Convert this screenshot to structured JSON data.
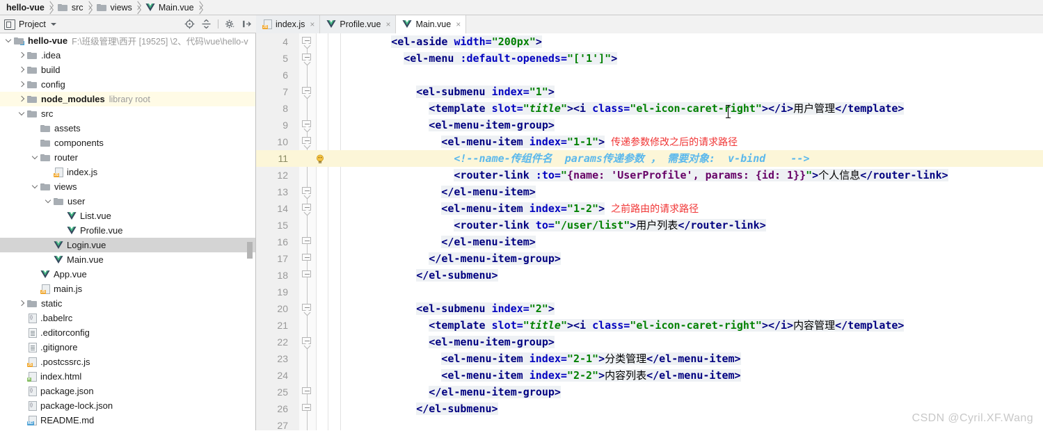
{
  "breadcrumb": {
    "items": [
      {
        "label": "hello-vue",
        "icon": "none",
        "bold": true
      },
      {
        "label": "src",
        "icon": "folder-icon",
        "bold": false
      },
      {
        "label": "views",
        "icon": "folder-icon",
        "bold": false
      },
      {
        "label": "Main.vue",
        "icon": "vue-icon",
        "bold": false
      }
    ]
  },
  "toolbar": {
    "project_label": "Project",
    "icons": [
      {
        "name": "locate-target-icon",
        "title": "Select Opened File"
      },
      {
        "name": "collapse-all-icon",
        "title": "Collapse All"
      },
      {
        "name": "settings-gear-icon",
        "title": "Show Options Menu"
      },
      {
        "name": "hide-panel-icon",
        "title": "Hide"
      }
    ]
  },
  "tabs": [
    {
      "label": "index.js",
      "icon": "js-file-icon",
      "active": false,
      "close": "×"
    },
    {
      "label": "Profile.vue",
      "icon": "vue-file-icon",
      "active": false,
      "close": "×"
    },
    {
      "label": "Main.vue",
      "icon": "vue-file-icon",
      "active": true,
      "close": "×"
    }
  ],
  "project_tree": [
    {
      "depth": 0,
      "arrow": "down",
      "icon": "project-folder-icon",
      "label": "hello-vue",
      "bold": true,
      "sub": "F:\\班级管理\\西开 [19525] \\2、代码\\vue\\hello-v",
      "state": "normal"
    },
    {
      "depth": 1,
      "arrow": "right",
      "icon": "folder-icon",
      "label": ".idea",
      "bold": false,
      "sub": "",
      "state": "normal"
    },
    {
      "depth": 1,
      "arrow": "right",
      "icon": "folder-icon",
      "label": "build",
      "bold": false,
      "sub": "",
      "state": "normal"
    },
    {
      "depth": 1,
      "arrow": "right",
      "icon": "folder-icon",
      "label": "config",
      "bold": false,
      "sub": "",
      "state": "normal"
    },
    {
      "depth": 1,
      "arrow": "right",
      "icon": "folder-icon",
      "label": "node_modules",
      "bold": true,
      "sub": "library root",
      "state": "library"
    },
    {
      "depth": 1,
      "arrow": "down",
      "icon": "folder-icon",
      "label": "src",
      "bold": false,
      "sub": "",
      "state": "normal"
    },
    {
      "depth": 2,
      "arrow": "none",
      "icon": "folder-icon",
      "label": "assets",
      "bold": false,
      "sub": "",
      "state": "normal"
    },
    {
      "depth": 2,
      "arrow": "none",
      "icon": "folder-icon",
      "label": "components",
      "bold": false,
      "sub": "",
      "state": "normal"
    },
    {
      "depth": 2,
      "arrow": "down",
      "icon": "folder-icon",
      "label": "router",
      "bold": false,
      "sub": "",
      "state": "normal"
    },
    {
      "depth": 3,
      "arrow": "none",
      "icon": "js-file-icon",
      "label": "index.js",
      "bold": false,
      "sub": "",
      "state": "normal"
    },
    {
      "depth": 2,
      "arrow": "down",
      "icon": "folder-icon",
      "label": "views",
      "bold": false,
      "sub": "",
      "state": "normal"
    },
    {
      "depth": 3,
      "arrow": "down",
      "icon": "folder-icon",
      "label": "user",
      "bold": false,
      "sub": "",
      "state": "normal"
    },
    {
      "depth": 4,
      "arrow": "none",
      "icon": "vue-file-icon",
      "label": "List.vue",
      "bold": false,
      "sub": "",
      "state": "normal"
    },
    {
      "depth": 4,
      "arrow": "none",
      "icon": "vue-file-icon",
      "label": "Profile.vue",
      "bold": false,
      "sub": "",
      "state": "normal"
    },
    {
      "depth": 3,
      "arrow": "none",
      "icon": "vue-file-icon",
      "label": "Login.vue",
      "bold": false,
      "sub": "",
      "state": "selected"
    },
    {
      "depth": 3,
      "arrow": "none",
      "icon": "vue-file-icon",
      "label": "Main.vue",
      "bold": false,
      "sub": "",
      "state": "normal"
    },
    {
      "depth": 2,
      "arrow": "none",
      "icon": "vue-file-icon",
      "label": "App.vue",
      "bold": false,
      "sub": "",
      "state": "normal"
    },
    {
      "depth": 2,
      "arrow": "none",
      "icon": "js-file-icon",
      "label": "main.js",
      "bold": false,
      "sub": "",
      "state": "normal"
    },
    {
      "depth": 1,
      "arrow": "right",
      "icon": "folder-icon",
      "label": "static",
      "bold": false,
      "sub": "",
      "state": "normal"
    },
    {
      "depth": 1,
      "arrow": "none",
      "icon": "json-file-icon",
      "label": ".babelrc",
      "bold": false,
      "sub": "",
      "state": "normal"
    },
    {
      "depth": 1,
      "arrow": "none",
      "icon": "text-file-icon",
      "label": ".editorconfig",
      "bold": false,
      "sub": "",
      "state": "normal"
    },
    {
      "depth": 1,
      "arrow": "none",
      "icon": "text-file-icon",
      "label": ".gitignore",
      "bold": false,
      "sub": "",
      "state": "normal"
    },
    {
      "depth": 1,
      "arrow": "none",
      "icon": "js-file-icon",
      "label": ".postcssrc.js",
      "bold": false,
      "sub": "",
      "state": "normal"
    },
    {
      "depth": 1,
      "arrow": "none",
      "icon": "html-file-icon",
      "label": "index.html",
      "bold": false,
      "sub": "",
      "state": "normal"
    },
    {
      "depth": 1,
      "arrow": "none",
      "icon": "json-file-icon",
      "label": "package.json",
      "bold": false,
      "sub": "",
      "state": "normal"
    },
    {
      "depth": 1,
      "arrow": "none",
      "icon": "json-file-icon",
      "label": "package-lock.json",
      "bold": false,
      "sub": "",
      "state": "normal"
    },
    {
      "depth": 1,
      "arrow": "none",
      "icon": "md-file-icon",
      "label": "README.md",
      "bold": false,
      "sub": "",
      "state": "normal"
    }
  ],
  "editor": {
    "first_line": 4,
    "current_line": 11,
    "lines": [
      {
        "n": 4,
        "fold": "arrow",
        "html": "<span class=\"hl-tok\"><span class=\"t-tag\">&lt;el-aside </span><span class=\"t-attr\">width=</span><span class=\"t-str\">\"200px\"</span><span class=\"t-tag\">&gt;</span></span>",
        "indent": 8
      },
      {
        "n": 5,
        "fold": "arrow",
        "html": "<span class=\"hl-tok\"><span class=\"t-tag\">&lt;el-menu </span><span class=\"t-attr\">:default-openeds=</span><span class=\"t-str\">\"['1']\"</span><span class=\"t-tag\">&gt;</span></span>",
        "indent": 10
      },
      {
        "n": 6,
        "fold": "none",
        "html": "",
        "indent": 0
      },
      {
        "n": 7,
        "fold": "arrow",
        "html": "<span class=\"hl-tok\"><span class=\"t-tag\">&lt;el-submenu </span><span class=\"t-attr\">index=</span><span class=\"t-str\">\"1\"</span><span class=\"t-tag\">&gt;</span></span>",
        "indent": 12
      },
      {
        "n": 8,
        "fold": "none",
        "html": "<span class=\"hl-tok\"><span class=\"t-tag\">&lt;template </span><span class=\"t-attr\">slot=</span><span class=\"t-str t-italic\">\"title\"</span><span class=\"t-tag\">&gt;&lt;i </span><span class=\"t-attr\">class=</span><span class=\"t-str\">\"el-icon-caret-right\"</span><span class=\"t-tag\">&gt;&lt;/i&gt;</span><span class=\"t-cn\">用户管理</span><span class=\"t-tag\">&lt;/template&gt;</span></span>",
        "indent": 14
      },
      {
        "n": 9,
        "fold": "arrow",
        "html": "<span class=\"hl-tok\"><span class=\"t-tag\">&lt;el-menu-item-group&gt;</span></span>",
        "indent": 14
      },
      {
        "n": 10,
        "fold": "arrow",
        "html": "<span class=\"hl-tok\"><span class=\"t-tag\">&lt;el-menu-item </span><span class=\"t-attr\">index=</span><span class=\"t-str\">\"1-1\"</span><span class=\"t-tag\">&gt;</span></span> <span class=\"t-annot\">传递参数修改之后的请求路径</span>",
        "indent": 16
      },
      {
        "n": 11,
        "fold": "bulb",
        "html": "<span class=\"t-comment\">&lt;!--name-传组件名  params传递参数 ， 需要对象:  v-bind    --&gt;</span>",
        "indent": 18
      },
      {
        "n": 12,
        "fold": "none",
        "html": "<span class=\"hl-tok\"><span class=\"t-tag\">&lt;router-link </span><span class=\"t-attr\">:to=</span><span class=\"t-str\">\"</span><span class=\"t-purple\">{name: 'UserProfile', params: {id: 1}}</span><span class=\"t-str\">\"</span><span class=\"t-tag\">&gt;</span><span class=\"t-cn\">个人信息</span><span class=\"t-tag\">&lt;/router-link&gt;</span></span>",
        "indent": 18
      },
      {
        "n": 13,
        "fold": "arrow",
        "html": "<span class=\"hl-tok\"><span class=\"t-tag\">&lt;/el-menu-item&gt;</span></span>",
        "indent": 16
      },
      {
        "n": 14,
        "fold": "arrow",
        "html": "<span class=\"hl-tok\"><span class=\"t-tag\">&lt;el-menu-item </span><span class=\"t-attr\">index=</span><span class=\"t-str\">\"1-2\"</span><span class=\"t-tag\">&gt;</span></span> <span class=\"t-annot\">之前路由的请求路径</span>",
        "indent": 16
      },
      {
        "n": 15,
        "fold": "none",
        "html": "<span class=\"hl-tok\"><span class=\"t-tag\">&lt;router-link </span><span class=\"t-attr\">to=</span><span class=\"t-str\">\"/user/list\"</span><span class=\"t-tag\">&gt;</span><span class=\"t-cn\">用户列表</span><span class=\"t-tag\">&lt;/router-link&gt;</span></span>",
        "indent": 18
      },
      {
        "n": 16,
        "fold": "plain",
        "html": "<span class=\"hl-tok\"><span class=\"t-tag\">&lt;/el-menu-item&gt;</span></span>",
        "indent": 16
      },
      {
        "n": 17,
        "fold": "plain",
        "html": "<span class=\"hl-tok\"><span class=\"t-tag\">&lt;/el-menu-item-group&gt;</span></span>",
        "indent": 14
      },
      {
        "n": 18,
        "fold": "plain",
        "html": "<span class=\"hl-tok\"><span class=\"t-tag\">&lt;/el-submenu&gt;</span></span>",
        "indent": 12
      },
      {
        "n": 19,
        "fold": "none",
        "html": "",
        "indent": 0
      },
      {
        "n": 20,
        "fold": "arrow",
        "html": "<span class=\"hl-tok\"><span class=\"t-tag\">&lt;el-submenu </span><span class=\"t-attr\">index=</span><span class=\"t-str\">\"2\"</span><span class=\"t-tag\">&gt;</span></span>",
        "indent": 12
      },
      {
        "n": 21,
        "fold": "none",
        "html": "<span class=\"hl-tok\"><span class=\"t-tag\">&lt;template </span><span class=\"t-attr\">slot=</span><span class=\"t-str t-italic\">\"title\"</span><span class=\"t-tag\">&gt;&lt;i </span><span class=\"t-attr\">class=</span><span class=\"t-str\">\"el-icon-caret-right\"</span><span class=\"t-tag\">&gt;&lt;/i&gt;</span><span class=\"t-cn\">内容管理</span><span class=\"t-tag\">&lt;/template&gt;</span></span>",
        "indent": 14
      },
      {
        "n": 22,
        "fold": "arrow",
        "html": "<span class=\"hl-tok\"><span class=\"t-tag\">&lt;el-menu-item-group&gt;</span></span>",
        "indent": 14
      },
      {
        "n": 23,
        "fold": "none",
        "html": "<span class=\"hl-tok\"><span class=\"t-tag\">&lt;el-menu-item </span><span class=\"t-attr\">index=</span><span class=\"t-str\">\"2-1\"</span><span class=\"t-tag\">&gt;</span><span class=\"t-cn\">分类管理</span><span class=\"t-tag\">&lt;/el-menu-item&gt;</span></span>",
        "indent": 16
      },
      {
        "n": 24,
        "fold": "none",
        "html": "<span class=\"hl-tok\"><span class=\"t-tag\">&lt;el-menu-item </span><span class=\"t-attr\">index=</span><span class=\"t-str\">\"2-2\"</span><span class=\"t-tag\">&gt;</span><span class=\"t-cn\">内容列表</span><span class=\"t-tag\">&lt;/el-menu-item&gt;</span></span>",
        "indent": 16
      },
      {
        "n": 25,
        "fold": "plain",
        "html": "<span class=\"hl-tok\"><span class=\"t-tag\">&lt;/el-menu-item-group&gt;</span></span>",
        "indent": 14
      },
      {
        "n": 26,
        "fold": "plain",
        "html": "<span class=\"hl-tok\"><span class=\"t-tag\">&lt;/el-submenu&gt;</span></span>",
        "indent": 12
      },
      {
        "n": 27,
        "fold": "none",
        "html": "",
        "indent": 0
      }
    ]
  },
  "watermark": "CSDN @Cyril.XF.Wang",
  "colors": {
    "tag": "#000080",
    "attribute": "#0000c0",
    "string": "#008000",
    "comment": "#5bb8ec",
    "annotation": "#f03434",
    "current_line_bg": "#fcf6d8",
    "library_row_bg": "#fffbe6",
    "selection_bg": "#d4d4d4",
    "vue_green": "#41b883"
  }
}
